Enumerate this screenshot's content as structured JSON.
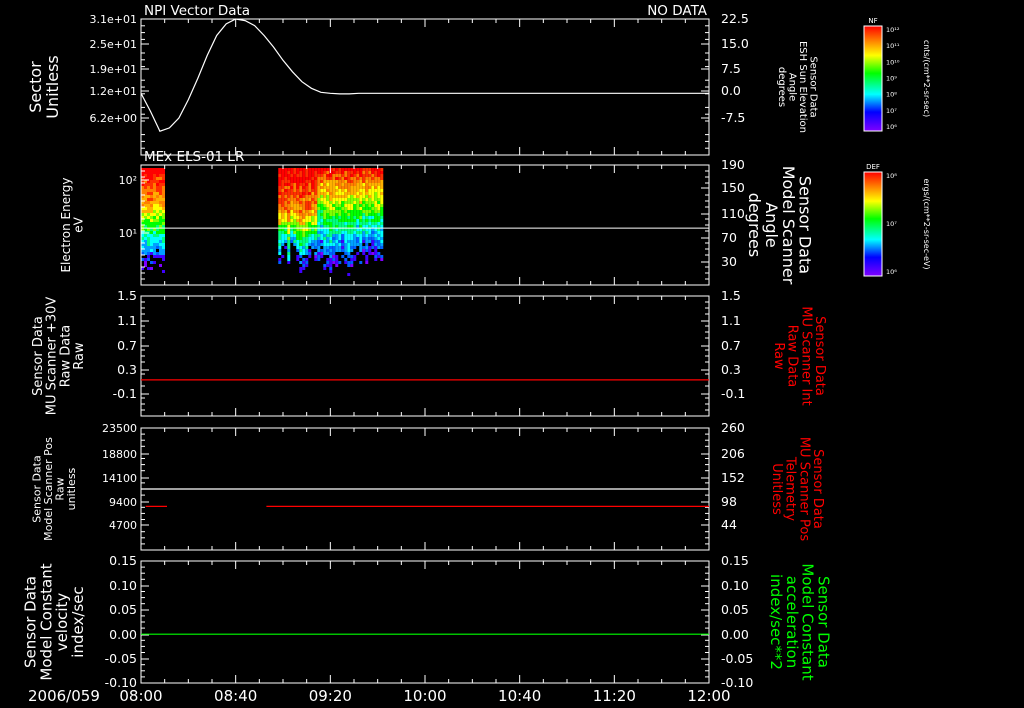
{
  "chart_data": [
    {
      "type": "line",
      "title_left": "NPI Vector Data",
      "title_right": "NO DATA",
      "ylabel_left": [
        "Sector",
        "Unitless"
      ],
      "ylabel_right": [
        "Sensor Data",
        "ESH Sun Elevation",
        "Angle",
        "degrees"
      ],
      "yticks_left": [
        "3.1e+01",
        "2.5e+01",
        "1.9e+01",
        "1.2e+01",
        "6.2e+00"
      ],
      "yticks_right": [
        "22.5",
        "15.0",
        "7.5",
        "0.0",
        "-7.5"
      ],
      "ylim_right": [
        -15,
        22.5
      ],
      "series": [
        {
          "color": "#ffffff",
          "x": [
            "08:00",
            "08:04",
            "08:08",
            "08:12",
            "08:16",
            "08:20",
            "08:24",
            "08:28",
            "08:32",
            "08:36",
            "08:40",
            "08:44",
            "08:48",
            "08:52",
            "08:56",
            "09:00",
            "09:04",
            "09:08",
            "09:12",
            "09:16",
            "09:20",
            "09:24",
            "09:28",
            "09:32",
            "09:36",
            "09:40",
            "09:44",
            "09:48",
            "10:00",
            "10:40",
            "11:20",
            "12:00"
          ],
          "values": [
            0.0,
            -5.5,
            -11.5,
            -10.5,
            -7.5,
            -2.0,
            4.5,
            11.5,
            17.5,
            21.0,
            22.5,
            22.0,
            20.5,
            17.5,
            14.0,
            10.0,
            6.5,
            3.5,
            1.5,
            0.3,
            0.0,
            -0.2,
            -0.2,
            0.0,
            0.0,
            0.0,
            0.0,
            0.0,
            0.0,
            0.0,
            0.0,
            0.0
          ]
        }
      ]
    },
    {
      "type": "heatmap",
      "title_left": "MEx ELS-01 LR",
      "ylabel_left": [
        "Electron Energy",
        "eV"
      ],
      "ylabel_right": [
        "Sensor Data",
        "Model Scanner",
        "Angle",
        "degrees"
      ],
      "yticks_left": [
        "10²",
        "10¹"
      ],
      "yticks_right": [
        "190",
        "150",
        "110",
        "70",
        "30"
      ],
      "ylim_right": [
        0,
        190
      ],
      "data_blocks": [
        {
          "start": "08:00",
          "end": "08:10"
        },
        {
          "start": "08:58",
          "end": "09:42"
        }
      ],
      "line": {
        "color": "#ffffff",
        "value": 90
      },
      "colorbar": {
        "label": "DEF",
        "units": "ergs/(cm**2-sr-sec-eV)",
        "ticks": [
          "10⁸",
          "10⁷",
          "10⁶"
        ]
      }
    },
    {
      "type": "line",
      "ylabel_left": [
        "Sensor Data",
        "MU Scanner +30V",
        "Raw Data",
        "Raw"
      ],
      "ylabel_right": [
        "Sensor Data",
        "MU Scanner Int",
        "Raw Data",
        "Raw"
      ],
      "yticks_left": [
        "1.5",
        "1.1",
        "0.7",
        "0.3",
        "-0.1"
      ],
      "yticks_right": [
        "1.5",
        "1.1",
        "0.7",
        "0.3",
        "-0.1"
      ],
      "ylim": [
        -0.4,
        1.5
      ],
      "series": [
        {
          "color": "#ff0000",
          "x": [
            "08:00",
            "12:00"
          ],
          "values": [
            0.0,
            0.0
          ]
        }
      ]
    },
    {
      "type": "line",
      "ylabel_left": [
        "Sensor Data",
        "Model Scanner Pos",
        "Raw",
        "unitless"
      ],
      "ylabel_right": [
        "Sensor Data",
        "MU Scanner Pos",
        "Telemetry",
        "Unitless"
      ],
      "yticks_left": [
        "23500",
        "18800",
        "14100",
        "9400",
        "4700"
      ],
      "yticks_right": [
        "260",
        "206",
        "152",
        "98",
        "44"
      ],
      "ylim_left": [
        0,
        23500
      ],
      "ylim_right": [
        0,
        260
      ],
      "series": [
        {
          "color": "#ffffff",
          "x": [
            "08:00",
            "12:00"
          ],
          "values_left": [
            11750,
            11750
          ]
        },
        {
          "color": "#ff0000",
          "x": [
            "08:02",
            "08:11"
          ],
          "values_left": [
            8400,
            8400
          ]
        },
        {
          "color": "#ff0000",
          "x": [
            "08:53",
            "12:00"
          ],
          "values_left": [
            8400,
            8400
          ]
        }
      ]
    },
    {
      "type": "line",
      "ylabel_left": [
        "Sensor Data",
        "Model Constant",
        "velocity",
        "index/sec"
      ],
      "ylabel_right": [
        "Sensor Data",
        "Model Constant",
        "acceleration",
        "index/sec**2"
      ],
      "yticks_left": [
        "0.15",
        "0.10",
        "0.05",
        "0.00",
        "-0.05",
        "-0.10"
      ],
      "yticks_right": [
        "0.15",
        "0.10",
        "0.05",
        "0.00",
        "-0.05",
        "-0.10"
      ],
      "ylim": [
        -0.1,
        0.15
      ],
      "series": [
        {
          "color": "#00ff00",
          "x": [
            "08:00",
            "12:00"
          ],
          "values": [
            0.0,
            0.0
          ]
        }
      ]
    }
  ],
  "colorbars": [
    {
      "label": "NF",
      "units": "cnts/(cm**2-sr-sec)",
      "ticks": [
        "10¹²",
        "10¹¹",
        "10¹⁰",
        "10⁹",
        "10⁸",
        "10⁷",
        "10⁶"
      ]
    },
    {
      "label": "DEF",
      "units": "ergs/(cm**2-sr-sec-eV)",
      "ticks": [
        "10⁸",
        "10⁷",
        "10⁶"
      ]
    }
  ],
  "x_axis": {
    "date": "2006/059",
    "ticks": [
      "08:00",
      "08:40",
      "09:20",
      "10:00",
      "10:40",
      "11:20",
      "12:00"
    ]
  }
}
